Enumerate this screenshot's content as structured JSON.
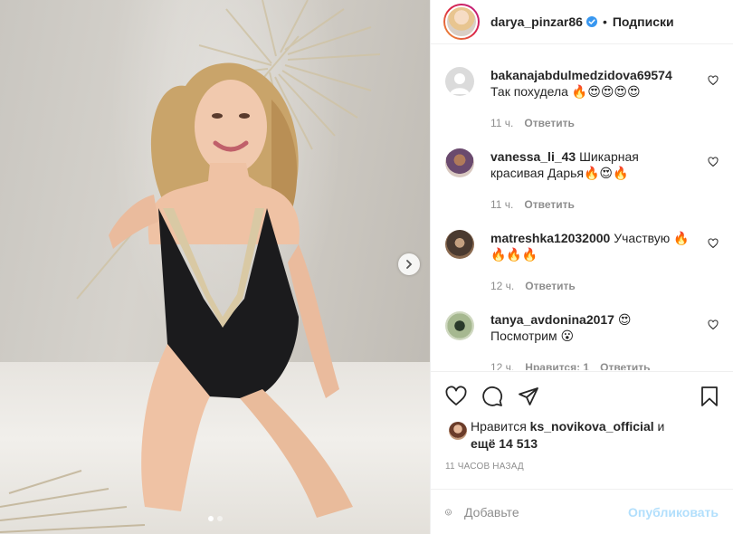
{
  "post": {
    "owner": "darya_pinzar86",
    "separator": "•",
    "follow_label": "Подписки",
    "carousel": {
      "slides": 2,
      "current": 1
    }
  },
  "comments": [
    {
      "user": "bakanajabdulmedzidova69574",
      "text": "Так похудела 🔥😍😍😍😍",
      "time": "11 ч.",
      "reply": "Ответить",
      "avatar": "default-avatar"
    },
    {
      "user": "vanessa_li_43",
      "text": "Шикарная красивая Дарья🔥😍🔥",
      "time": "11 ч.",
      "reply": "Ответить",
      "avatar": "vanessa-avatar"
    },
    {
      "user": "matreshka12032000",
      "text": "Участвую 🔥🔥🔥🔥",
      "time": "12 ч.",
      "reply": "Ответить",
      "avatar": "matreshka-avatar"
    },
    {
      "user": "tanya_avdonina2017",
      "text": "😍 Посмотрим 😮",
      "time": "12 ч.",
      "likes": "Нравится: 1",
      "reply": "Ответить",
      "avatar": "tanya-avatar"
    }
  ],
  "likes": {
    "prefix": "Нравится",
    "user": "ks_novikova_official",
    "conj": "и",
    "more": "ещё 14 513"
  },
  "timestamp": "11 ЧАСОВ НАЗАД",
  "composer": {
    "placeholder": "Добавьте",
    "publish_label": "Опубликовать"
  },
  "colors": {
    "verified": "#3897f0",
    "publish_disabled": "#b2dffc",
    "muted": "#8e8e8e"
  },
  "icons": [
    "heart-icon",
    "comment-icon",
    "share-icon",
    "bookmark-icon",
    "emoji-icon",
    "chevron-right-icon",
    "verified-badge-icon"
  ]
}
